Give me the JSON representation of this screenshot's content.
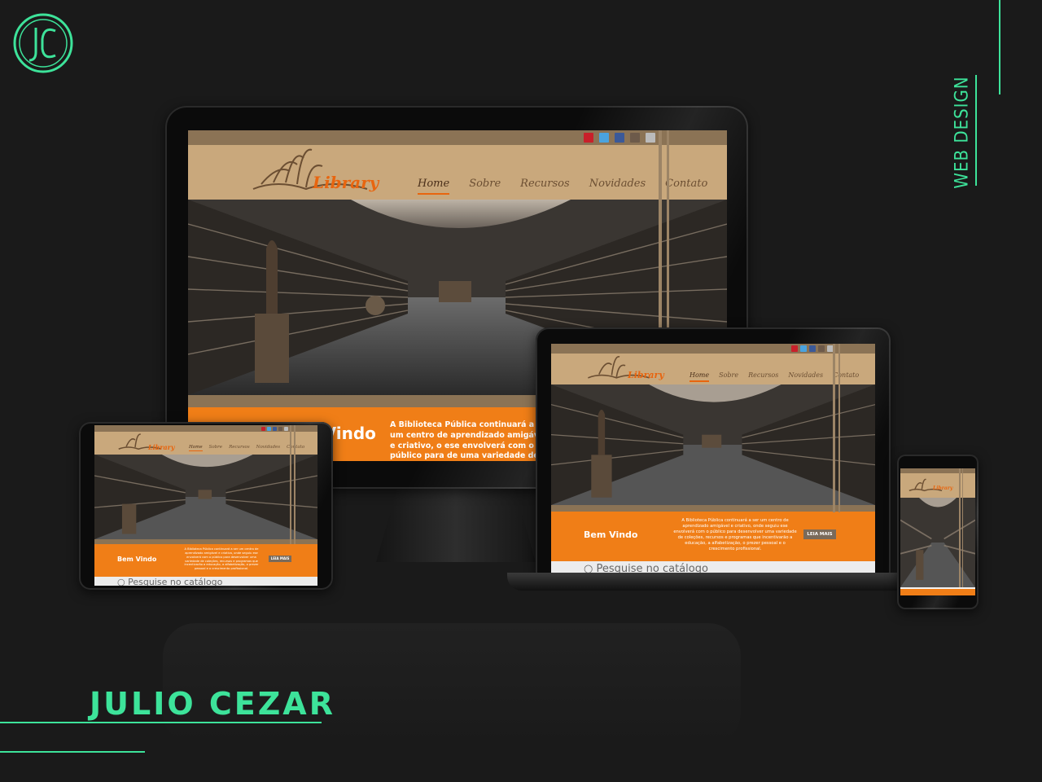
{
  "brand": {
    "monogram": "JC",
    "accent_color": "#3de39a",
    "side_label": "WEB DESIGN",
    "author": "JULIO CEZAR"
  },
  "site": {
    "logo_text": "Library",
    "nav": [
      "Home",
      "Sobre",
      "Recursos",
      "Novidades",
      "Contato"
    ],
    "social_icons": [
      "youtube-icon",
      "twitter-icon",
      "facebook-icon",
      "instagram-icon",
      "generic-icon"
    ],
    "welcome": "Bem Vindo",
    "description": "A Biblioteca Pública continuará a ser um centro de aprendizado amigável e criativo, onde seguiu ese envolverá com o público para desenvolver uma variedade de coleções, recursos e programas que incentivarão a educação, a alfabetização, o prezer pessoal e o crescimento profissional.",
    "description_desktop": "A Biblioteca Pública continuará a ser um centro de aprendizado amigável e criativo, o ese envolverá com o público para de uma variedade de coleções, recursos que incentivarão a educação, a alfab",
    "read_more": "LEIA MAIS",
    "search_placeholder": "Pesquise no catálogo",
    "colors": {
      "orange": "#f07e17",
      "tan": "#c9a87c",
      "brown": "#8b7355"
    }
  }
}
